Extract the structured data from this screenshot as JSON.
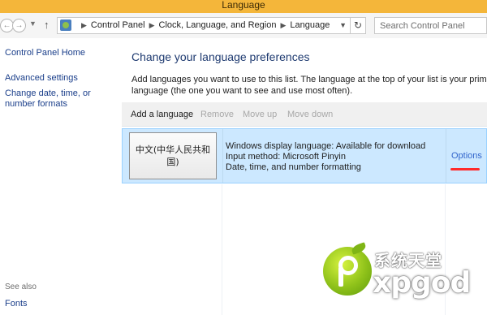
{
  "window": {
    "title": "Language"
  },
  "addressbar": {
    "back_icon": "back-arrow-icon",
    "forward_icon": "forward-arrow-icon",
    "recent_icon": "chevron-down-icon",
    "up_icon": "up-arrow-icon",
    "up_glyph": "↑",
    "breadcrumb": [
      "Control Panel",
      "Clock, Language, and Region",
      "Language"
    ],
    "refresh_glyph": "↻",
    "search_placeholder": "Search Control Panel"
  },
  "sidebar": {
    "items": [
      {
        "label": "Control Panel Home"
      },
      {
        "label": "Advanced settings"
      },
      {
        "label": "Change date, time, or number formats"
      }
    ],
    "see_also": "See also",
    "fonts": "Fonts"
  },
  "main": {
    "heading": "Change your language preferences",
    "intro": "Add languages you want to use to this list. The language at the top of your list is your primary language (the one you want to see and use most often).",
    "toolbar": {
      "add": "Add a language",
      "remove": "Remove",
      "move_up": "Move up",
      "move_down": "Move down"
    },
    "languages": [
      {
        "name": "中文(中华人民共和国)",
        "display_language": "Windows display language: Available for download",
        "input_method": "Input method: Microsoft Pinyin",
        "formatting": "Date, time, and number formatting",
        "options": "Options"
      }
    ]
  },
  "watermark": {
    "cn": "系统天堂",
    "en": "xpgod"
  },
  "colors": {
    "title_bar": "#f4b63a",
    "selected_row": "#cce8ff",
    "link": "#1a3e8a",
    "annotation_underline": "#ff2b2b"
  }
}
